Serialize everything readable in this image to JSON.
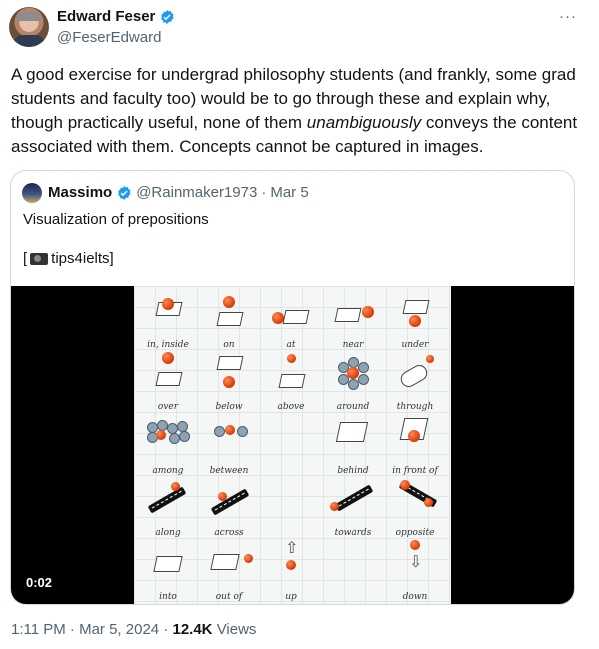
{
  "author": {
    "name": "Edward Feser",
    "handle": "@FeserEdward",
    "more_label": "···"
  },
  "tweet": {
    "text_before": "A good exercise for undergrad philosophy students (and frankly, some grad students and faculty too) would be to go through these and explain why, though practically useful, none of them ",
    "emphasis": "unambiguously",
    "text_after": " conveys the content associated with them. Concepts cannot be captured in images."
  },
  "quote": {
    "name": "Massimo",
    "handle": "@Rainmaker1973",
    "separator": "·",
    "date": "Mar 5",
    "line1": "Visualization of prepositions",
    "line2_open": "[",
    "line2_text": " tips4ielts]",
    "video_time": "0:02"
  },
  "image_labels": [
    "in, inside",
    "on",
    "at",
    "near",
    "under",
    "over",
    "below",
    "above",
    "around",
    "through",
    "among",
    "between",
    "behind",
    "in front of",
    "along",
    "across",
    "towards",
    "opposite",
    "into",
    "out of",
    "up",
    "down"
  ],
  "footer": {
    "time": "1:11 PM",
    "separator": "·",
    "date": "Mar 5, 2024",
    "separator2": "·",
    "views_count": "12.4K",
    "views_label": "Views"
  },
  "colors": {
    "verified_blue": "#1d9bf0",
    "muted_text": "#536471",
    "border": "#cfd9de"
  },
  "icons": [
    "verified-icon",
    "more-icon",
    "camera-icon"
  ]
}
